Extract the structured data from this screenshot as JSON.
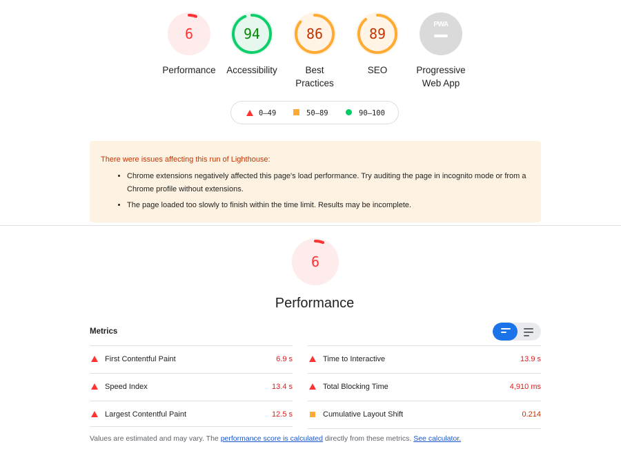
{
  "gauges": [
    {
      "score": "6",
      "label": "Performance",
      "value": 6,
      "color": "#ff3333",
      "bg": "#fdeceb"
    },
    {
      "score": "94",
      "label": "Accessibility",
      "value": 94,
      "color": "#0cce6b",
      "bg": "#e6f8ee"
    },
    {
      "score": "86",
      "label_line1": "Best",
      "label_line2": "Practices",
      "value": 86,
      "color": "#ffaa33",
      "bg": "#fff4e5"
    },
    {
      "score": "89",
      "label": "SEO",
      "value": 89,
      "color": "#ffaa33",
      "bg": "#fff4e5"
    }
  ],
  "pwa": {
    "badge": "PWA",
    "label_line1": "Progressive",
    "label_line2": "Web App",
    "color": "#dadada"
  },
  "legend": {
    "red_range": "0–49",
    "orange_range": "50–89",
    "green_range": "90–100"
  },
  "warning": {
    "title": "There were issues affecting this run of Lighthouse:",
    "items": [
      "Chrome extensions negatively affected this page's load performance. Try auditing the page in incognito mode or from a Chrome profile without extensions.",
      "The page loaded too slowly to finish within the time limit. Results may be incomplete."
    ]
  },
  "performance": {
    "score": "6",
    "value": 6,
    "title": "Performance"
  },
  "metrics": {
    "heading": "Metrics",
    "left": [
      {
        "name": "First Contentful Paint",
        "value": "6.9 s",
        "status": "fail"
      },
      {
        "name": "Speed Index",
        "value": "13.4 s",
        "status": "fail"
      },
      {
        "name": "Largest Contentful Paint",
        "value": "12.5 s",
        "status": "fail"
      }
    ],
    "right": [
      {
        "name": "Time to Interactive",
        "value": "13.9 s",
        "status": "fail"
      },
      {
        "name": "Total Blocking Time",
        "value": "4,910 ms",
        "status": "fail"
      },
      {
        "name": "Cumulative Layout Shift",
        "value": "0.214",
        "status": "average"
      }
    ]
  },
  "footnote": {
    "prefix": "Values are estimated and may vary. The ",
    "link1": "performance score is calculated",
    "middle": " directly from these metrics. ",
    "link2": "See calculator."
  }
}
